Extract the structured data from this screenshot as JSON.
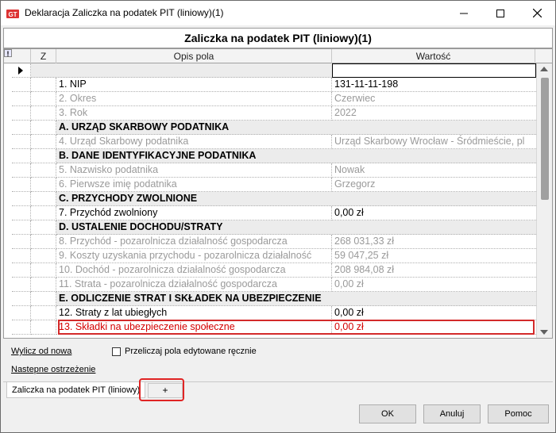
{
  "window": {
    "title": "Deklaracja Zaliczka na podatek PIT (liniowy)(1)",
    "icon": "tax-app-icon"
  },
  "form": {
    "title": "Zaliczka na podatek PIT (liniowy)(1)"
  },
  "grid": {
    "headers": {
      "warning": "!",
      "z": "Z",
      "opis": "Opis pola",
      "wartosc": "Wartość"
    },
    "rows": [
      {
        "kind": "field",
        "opis": "1. NIP",
        "wartosc": "131-11-11-198"
      },
      {
        "kind": "disabled",
        "opis": "2. Okres",
        "wartosc": "Czerwiec"
      },
      {
        "kind": "disabled",
        "opis": "3. Rok",
        "wartosc": "2022"
      },
      {
        "kind": "section",
        "opis": "A. URZĄD SKARBOWY PODATNIKA"
      },
      {
        "kind": "disabled",
        "opis": "4. Urząd Skarbowy podatnika",
        "wartosc": "Urząd Skarbowy Wrocław - Śródmieście, pl"
      },
      {
        "kind": "section",
        "opis": "B. DANE IDENTYFIKACYJNE PODATNIKA"
      },
      {
        "kind": "disabled",
        "opis": "5. Nazwisko podatnika",
        "wartosc": "Nowak"
      },
      {
        "kind": "disabled",
        "opis": "6. Pierwsze imię podatnika",
        "wartosc": "Grzegorz"
      },
      {
        "kind": "section",
        "opis": "C. PRZYCHODY ZWOLNIONE"
      },
      {
        "kind": "field",
        "opis": "7. Przychód zwolniony",
        "wartosc": "0,00 zł"
      },
      {
        "kind": "section",
        "opis": "D. USTALENIE DOCHODU/STRATY"
      },
      {
        "kind": "disabled",
        "opis": "8. Przychód - pozarolnicza działalność gospodarcza",
        "wartosc": "268 031,33 zł"
      },
      {
        "kind": "disabled",
        "opis": "9. Koszty uzyskania przychodu - pozarolnicza działalność",
        "wartosc": "59 047,25 zł"
      },
      {
        "kind": "disabled",
        "opis": "10. Dochód - pozarolnicza działalność gospodarcza",
        "wartosc": "208 984,08 zł"
      },
      {
        "kind": "disabled",
        "opis": "11. Strata - pozarolnicza działalność gospodarcza",
        "wartosc": "0,00 zł"
      },
      {
        "kind": "section",
        "opis": "E. ODLICZENIE STRAT I SKŁADEK NA UBEZPIECZENIE"
      },
      {
        "kind": "field",
        "opis": "12. Straty z lat ubiegłych",
        "wartosc": "0,00 zł"
      },
      {
        "kind": "highlight",
        "opis": "13. Składki na ubezpieczenie społeczne",
        "wartosc": "0,00 zł"
      }
    ]
  },
  "bottom": {
    "recalc_link": "Wylicz od nowa",
    "next_warning_link": "Nastepne ostrzeżenie",
    "recalc_checkbox_label": "Przeliczaj pola edytowane ręcznie",
    "recalc_checkbox_checked": false
  },
  "tabs": {
    "active": "Zaliczka na podatek PIT (liniowy)",
    "add_label": "+"
  },
  "buttons": {
    "ok": "OK",
    "cancel": "Anuluj",
    "help": "Pomoc"
  },
  "colors": {
    "highlight_red": "#d32a2a",
    "disabled_text": "#9a9a9a"
  }
}
